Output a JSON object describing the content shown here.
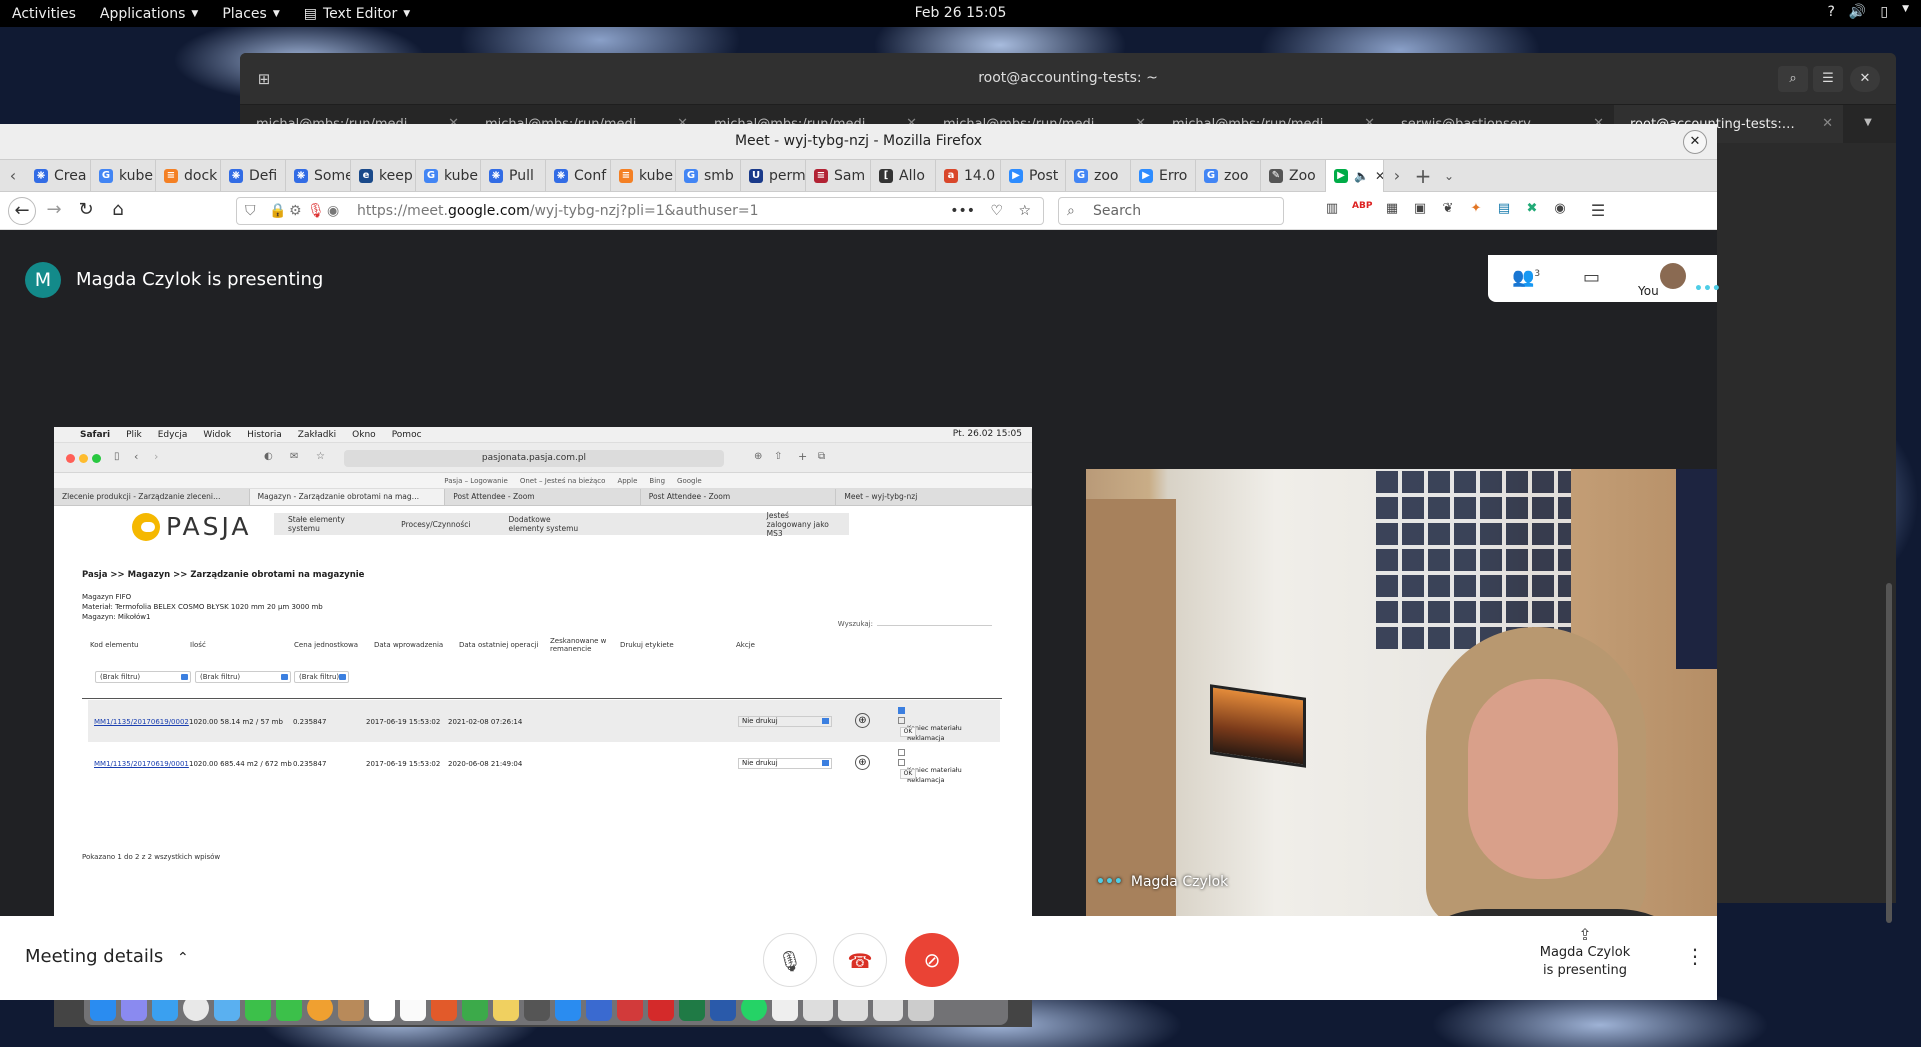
{
  "topbar": {
    "activities": "Activities",
    "applications": "Applications",
    "places": "Places",
    "text_editor": "Text Editor",
    "clock": "Feb 26  15:05"
  },
  "terminal": {
    "title": "root@accounting-tests: ~",
    "tabs": [
      "michal@mbs:/run/medi…",
      "michal@mbs:/run/medi…",
      "michal@mbs:/run/medi…",
      "michal@mbs:/run/medi…",
      "michal@mbs:/run/medi…",
      "serwis@bastionserv…",
      "root@accounting-tests:…"
    ]
  },
  "firefox": {
    "title": "Meet - wyj-tybg-nzj - Mozilla Firefox",
    "tabs": [
      {
        "label": "Crea",
        "icon": "kubernetes-icon",
        "color": "#326ce5"
      },
      {
        "label": "kube",
        "icon": "google-icon",
        "color": "#4285f4"
      },
      {
        "label": "dock",
        "icon": "stackoverflow-icon",
        "color": "#f48024"
      },
      {
        "label": "Defi",
        "icon": "kubernetes-icon",
        "color": "#326ce5"
      },
      {
        "label": "Some",
        "icon": "kubernetes-icon",
        "color": "#326ce5"
      },
      {
        "label": "keep",
        "icon": "e-icon",
        "color": "#1a4a8a"
      },
      {
        "label": "kube",
        "icon": "google-icon",
        "color": "#4285f4"
      },
      {
        "label": "Pull",
        "icon": "kubernetes-icon",
        "color": "#326ce5"
      },
      {
        "label": "Conf",
        "icon": "kubernetes-icon",
        "color": "#326ce5"
      },
      {
        "label": "kube",
        "icon": "stackoverflow-icon",
        "color": "#f48024"
      },
      {
        "label": "smb",
        "icon": "google-icon",
        "color": "#4285f4"
      },
      {
        "label": "perm",
        "icon": "u-icon",
        "color": "#1a3a8a"
      },
      {
        "label": "Sam",
        "icon": "flag-icon",
        "color": "#b22234"
      },
      {
        "label": "Allo",
        "icon": "bracket-icon",
        "color": "#333333"
      },
      {
        "label": "14.0",
        "icon": "ask-icon",
        "color": "#d9472b"
      },
      {
        "label": "Post",
        "icon": "zoom-icon",
        "color": "#2d8cff"
      },
      {
        "label": "zoo",
        "icon": "google-icon",
        "color": "#4285f4"
      },
      {
        "label": "Erro",
        "icon": "zoom-icon",
        "color": "#2d8cff"
      },
      {
        "label": "zoo",
        "icon": "google-icon",
        "color": "#4285f4"
      },
      {
        "label": "Zoo",
        "icon": "pen-icon",
        "color": "#555555"
      }
    ],
    "url_prefix": "https://meet.",
    "url_domain": "google.com",
    "url_path": "/wyj-tybg-nzj?pli=1&authuser=1",
    "search_placeholder": "Search"
  },
  "meet": {
    "presenter_initial": "M",
    "presenting_title": "Magda Czylok is presenting",
    "participants_count": "3",
    "you_label": "You",
    "video_name": "Magda Czylok",
    "meeting_details": "Meeting details",
    "present_line1": "Magda Czylok",
    "present_line2": "is presenting"
  },
  "shared": {
    "mac_menu": [
      "Safari",
      "Plik",
      "Edycja",
      "Widok",
      "Historia",
      "Zakładki",
      "Okno",
      "Pomoc"
    ],
    "mac_clock": "Pt. 26.02  15:05",
    "safari_url": "pasjonata.pasja.com.pl",
    "favorites": [
      "Pasja – Logowanie",
      "Onet – Jesteś na bieżąco",
      "Apple",
      "Bing",
      "Google"
    ],
    "tabs": [
      "Zlecenie produkcji - Zarządzanie zleceni…",
      "Magazyn - Zarządzanie obrotami na mag…",
      "Post Attendee - Zoom",
      "Post Attendee - Zoom",
      "Meet – wyj-tybg-nzj"
    ],
    "logo_text": "PASJA",
    "menu": [
      "Stałe elementy systemu",
      "Procesy/Czynności",
      "Dodatkowe elementy systemu",
      "Jesteś zalogowany jako MS3"
    ],
    "breadcrumb": "Pasja >> Magazyn >> Zarządzanie obrotami na magazynie",
    "info_lines": [
      "Magazyn FIFO",
      "Materiał: Termofolia BELEX COSMO BŁYSK 1020 mm 20 µm 3000 mb",
      "Magazyn: Mikołów1"
    ],
    "search_label": "Wyszukaj:",
    "columns": [
      "Kod elementu",
      "Ilość",
      "Cena jednostkowa",
      "Data wprowadzenia",
      "Data ostatniej operacji",
      "Zeskanowane w remanencie",
      "Drukuj etykiete",
      "Akcje"
    ],
    "filter_text": "(Brak filtru)",
    "rows": [
      {
        "code": "MM1/1135/20170619/0002",
        "qty": "1020.00 58.14 m2 / 57 mb",
        "price": "0.235847",
        "date_in": "2017-06-19 15:53:02",
        "date_last": "2021-02-08 07:26:14",
        "print": "Nie drukuj",
        "check1": "Koniec materiału",
        "check2": "Reklamacja",
        "ok": "OK"
      },
      {
        "code": "MM1/1135/20170619/0001",
        "qty": "1020.00 685.44 m2 / 672 mb",
        "price": "0.235847",
        "date_in": "2017-06-19 15:53:02",
        "date_last": "2020-06-08 21:49:04",
        "print": "Nie drukuj",
        "check1": "Koniec materiału",
        "check2": "Reklamacja",
        "ok": "OK"
      }
    ],
    "footer": "Pokazano 1 do 2 z 2 wszystkich wpisów"
  }
}
